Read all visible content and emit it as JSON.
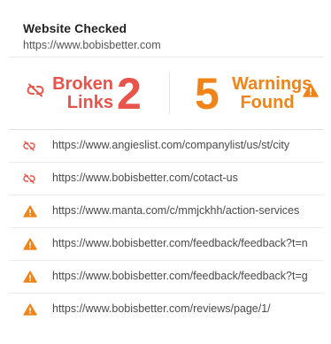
{
  "header": {
    "title": "Website Checked",
    "site": "https://www.bobisbetter.com"
  },
  "summary": {
    "broken_label_line1": "Broken",
    "broken_label_line2": "Links",
    "broken_count": "2",
    "warning_count": "5",
    "warning_label_line1": "Warnings",
    "warning_label_line2": "Found"
  },
  "colors": {
    "broken": "#e8534a",
    "warning": "#f08418"
  },
  "rows": [
    {
      "icon": "broken-link-icon",
      "url": "https://www.angieslist.com/companylist/us/st/city"
    },
    {
      "icon": "broken-link-icon",
      "url": "https://www.bobisbetter.com/cotact-us"
    },
    {
      "icon": "warning-icon",
      "url": "https://www.manta.com/c/mmjckhh/action-services"
    },
    {
      "icon": "warning-icon",
      "url": "https://www.bobisbetter.com/feedback/feedback?t=n"
    },
    {
      "icon": "warning-icon",
      "url": "https://www.bobisbetter.com/feedback/feedback?t=g"
    },
    {
      "icon": "warning-icon",
      "url": "https://www.bobisbetter.com/reviews/page/1/"
    }
  ]
}
